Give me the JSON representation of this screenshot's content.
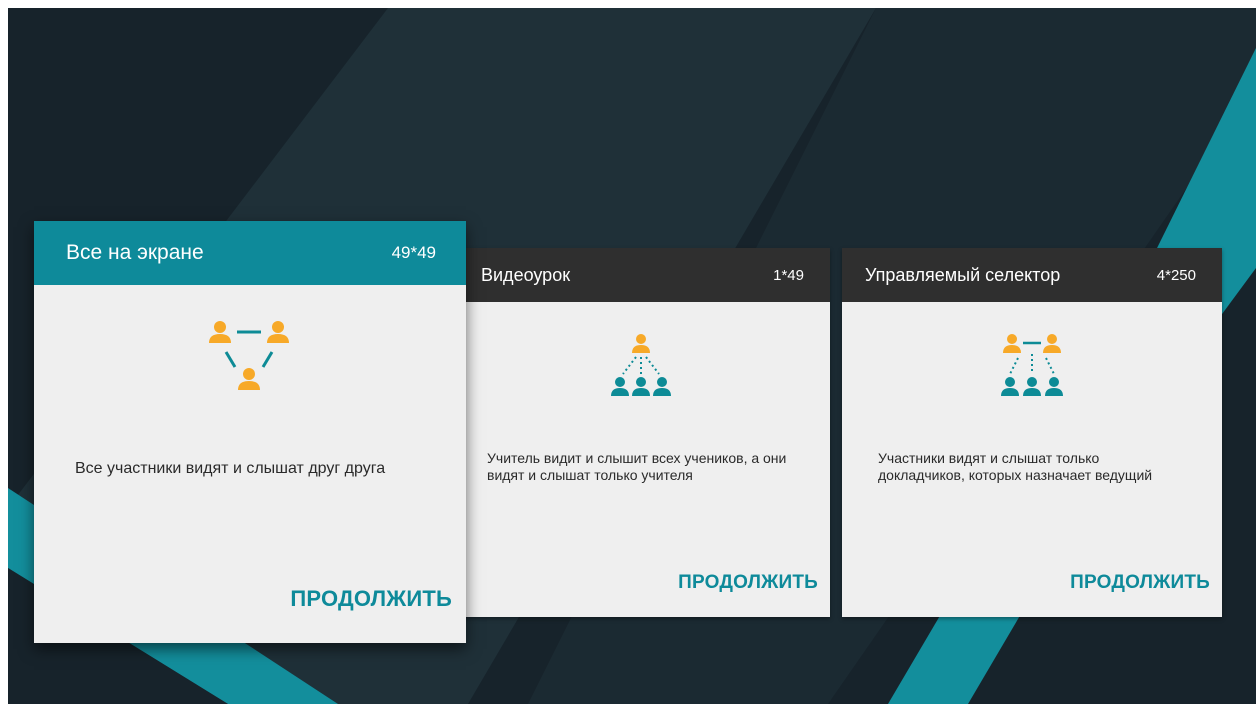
{
  "theme": {
    "accent": "#0e8a9a",
    "background": "#17232b",
    "card_body": "#efefef",
    "inactive_header": "#2f2f2f",
    "person_primary": "#f7a928",
    "person_secondary": "#0d8b96"
  },
  "modes": [
    {
      "title": "Все на экране",
      "count": "49*49",
      "icon": "triangle-participants-icon",
      "description": "Все участники видят и слышат друг друга",
      "action": "ПРОДОЛЖИТЬ",
      "selected": true
    },
    {
      "title": "Видеоурок",
      "count": "1*49",
      "icon": "teacher-students-icon",
      "description": "Учитель видит и слышит всех учеников, а они видят и слышат только учителя",
      "action": "ПРОДОЛЖИТЬ",
      "selected": false
    },
    {
      "title": "Управляемый селектор",
      "count": "4*250",
      "icon": "speakers-audience-icon",
      "description": "Участники видят и слышат только докладчиков, которых назначает ведущий",
      "action": "ПРОДОЛЖИТЬ",
      "selected": false
    }
  ]
}
